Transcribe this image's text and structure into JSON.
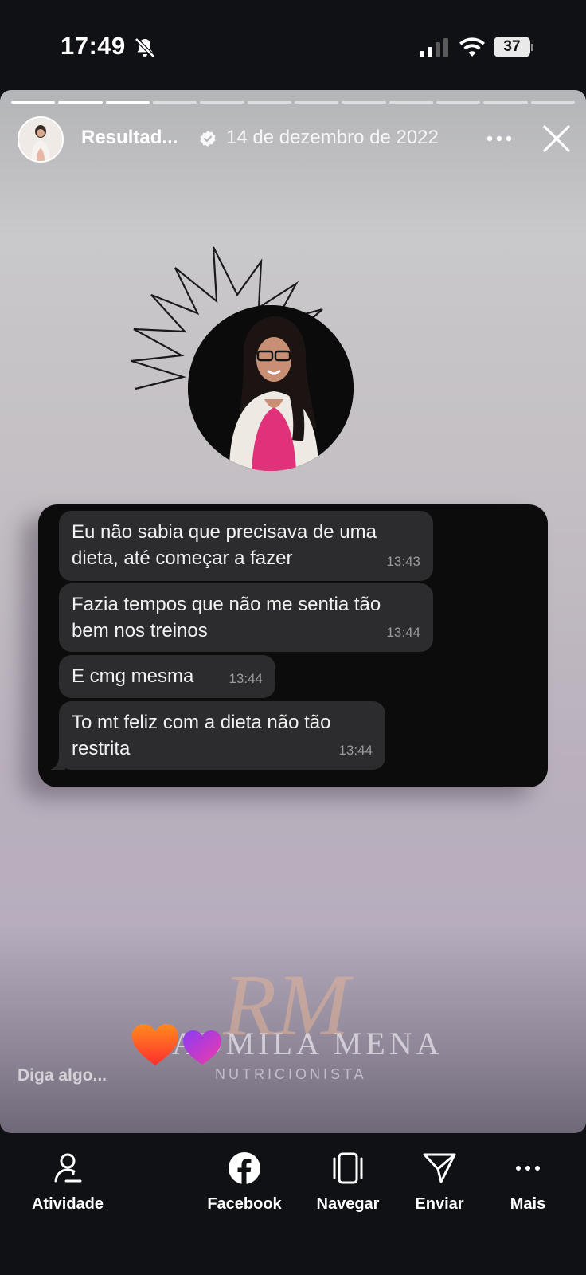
{
  "status_bar": {
    "time": "17:49",
    "battery": "37"
  },
  "story": {
    "username": "Resultad...",
    "date": "14 de dezembro de 2022",
    "progress_total": 12,
    "progress_done": 3,
    "reply_placeholder": "Diga algo..."
  },
  "chat": {
    "messages": [
      {
        "text": "Eu não sabia que precisava de uma dieta, até começar a fazer",
        "time": "13:43"
      },
      {
        "text": "Fazia tempos que não me sentia tão bem nos treinos",
        "time": "13:44"
      },
      {
        "text": "E cmg mesma",
        "time": "13:44"
      },
      {
        "text": "To mt feliz com a dieta não tão restrita",
        "time": "13:44"
      }
    ]
  },
  "watermark": {
    "monogram": "RM",
    "name": "ADMILA MENA",
    "subtitle": "NUTRICIONISTA"
  },
  "bottom_bar": {
    "actions": [
      {
        "label": "Atividade",
        "icon": "activity-icon"
      },
      {
        "label": "Facebook",
        "icon": "facebook-icon"
      },
      {
        "label": "Navegar",
        "icon": "browse-icon"
      },
      {
        "label": "Enviar",
        "icon": "send-icon"
      },
      {
        "label": "Mais",
        "icon": "more-horizontal-icon"
      }
    ]
  },
  "colors": {
    "bubble": "#2c2c2e",
    "chat_background": "#0c0c0d",
    "heart_orange": "#ff5a1f",
    "heart_purple": "#c13cf0"
  }
}
